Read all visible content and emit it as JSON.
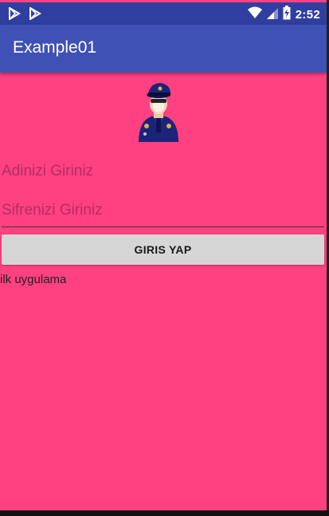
{
  "status_bar": {
    "time": "2:52",
    "left_icons": [
      "play-store-notification-icon",
      "play-store-notification-icon"
    ],
    "right_icons": [
      "wifi-icon",
      "cell-signal-icon",
      "battery-charging-icon"
    ],
    "color": "#303f9f"
  },
  "app_bar": {
    "title": "Example01",
    "color": "#3f51b5"
  },
  "avatar": {
    "icon": "police-officer-icon"
  },
  "form": {
    "name_placeholder": "Adinizi Giriniz",
    "password_placeholder": "Sifrenizi Giriniz",
    "submit_label": "GIRIS YAP"
  },
  "caption": "ilk uygulama",
  "colors": {
    "background": "#ff4081",
    "button": "#d6d6d6"
  }
}
